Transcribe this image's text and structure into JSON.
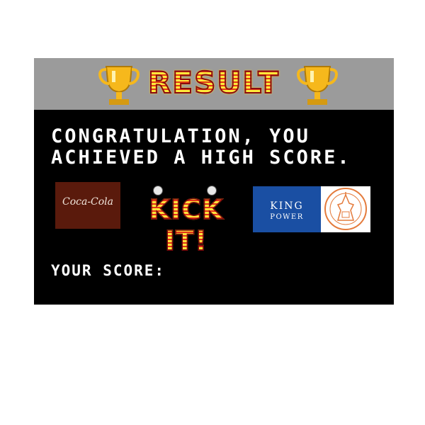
{
  "header": {
    "title": "RESULT"
  },
  "message": {
    "line1": "CONGRATULATION, YOU",
    "line2": "ACHIEVED A HIGH SCORE."
  },
  "sponsors": {
    "coke": "Coca-Cola",
    "game_logo": "KICK IT!",
    "king_power_line1": "KING",
    "king_power_line2": "POWER"
  },
  "score": {
    "label": "YOUR SCORE:"
  },
  "colors": {
    "header_bg": "#9b9b9b",
    "panel_bg": "#000000",
    "title_yellow": "#ffe93b",
    "title_red": "#e23a14",
    "trophy_gold": "#f6b81c",
    "coke_bg": "#5a1a0c",
    "king_power_blue": "#1a4fa3",
    "seal_orange": "#e47b3c"
  }
}
